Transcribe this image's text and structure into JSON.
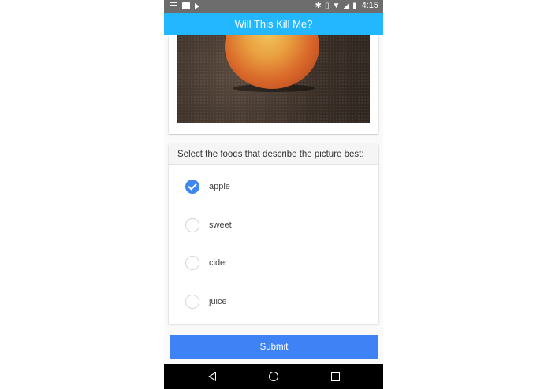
{
  "status_bar": {
    "time": "4:15",
    "left_icons": [
      "calendar-icon",
      "image-icon",
      "play-icon"
    ],
    "right_icons": [
      "bluetooth-icon",
      "vibrate-icon",
      "wifi-icon",
      "signal-icon",
      "battery-icon"
    ]
  },
  "app_bar": {
    "title": "Will This Kill Me?"
  },
  "question": {
    "prompt": "Select the foods that describe the picture best:",
    "options": [
      {
        "label": "apple",
        "checked": true
      },
      {
        "label": "sweet",
        "checked": false
      },
      {
        "label": "cider",
        "checked": false
      },
      {
        "label": "juice",
        "checked": false
      }
    ]
  },
  "submit_label": "Submit",
  "nav_bar": {
    "buttons": [
      "back-icon",
      "home-icon",
      "recents-icon"
    ]
  },
  "colors": {
    "app_bar": "#22b7ff",
    "accent": "#3f87ee",
    "submit": "#3f82f5",
    "status_bar": "#6d6d6d"
  }
}
